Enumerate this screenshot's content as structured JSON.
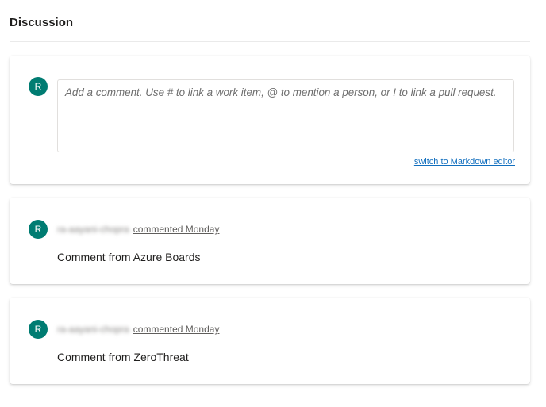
{
  "discussion": {
    "title": "Discussion",
    "new_comment": {
      "avatar_initial": "R",
      "placeholder": "Add a comment. Use # to link a work item, @ to mention a person, or ! to link a pull request.",
      "markdown_link": "switch to Markdown editor"
    },
    "comments": [
      {
        "avatar_initial": "R",
        "author": "ra-aayani-chopra",
        "time": "commented Monday",
        "text": "Comment from Azure Boards"
      },
      {
        "avatar_initial": "R",
        "author": "ra-aayani-chopra",
        "time": "commented Monday",
        "text": "Comment from ZeroThreat"
      }
    ]
  },
  "colors": {
    "avatar_bg": "#007c72",
    "link": "#106ebe"
  }
}
